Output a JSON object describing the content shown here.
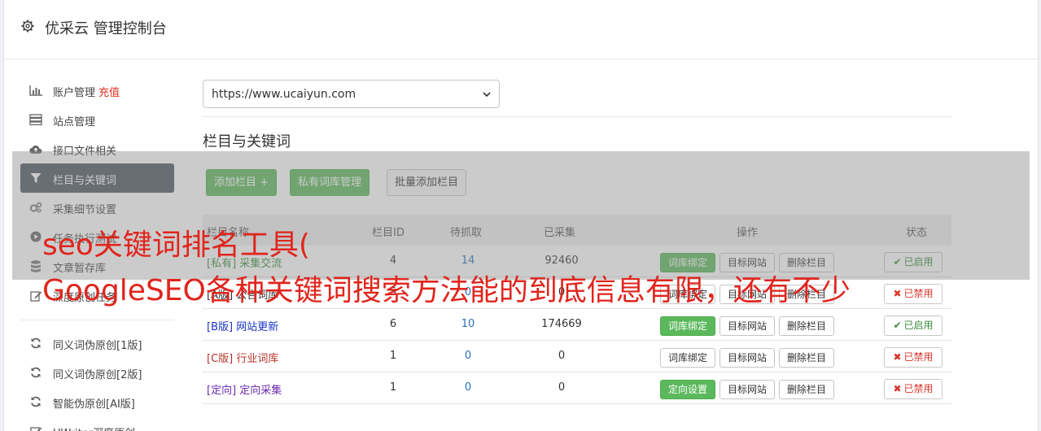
{
  "header": {
    "title": "优采云 管理控制台",
    "icon": "gear-icon"
  },
  "sidebar": {
    "group1": [
      {
        "label": "账户管理",
        "extra": "充值",
        "icon": "bar-chart-icon"
      },
      {
        "label": "站点管理",
        "icon": "server-icon"
      },
      {
        "label": "接口文件相关",
        "icon": "cloud-upload-icon"
      },
      {
        "label": "栏目与关键词",
        "icon": "filter-icon",
        "active": true
      },
      {
        "label": "采集细节设置",
        "icon": "cogs-icon"
      },
      {
        "label": "任务执行测试",
        "icon": "play-circle-icon"
      },
      {
        "label": "文章暂存库",
        "icon": "database-icon"
      },
      {
        "label": "深度原创任务",
        "icon": "edit-icon"
      }
    ],
    "group2": [
      {
        "label": "同义词伪原创[1版]",
        "icon": "refresh-icon"
      },
      {
        "label": "同义词伪原创[2版]",
        "icon": "refresh-icon"
      },
      {
        "label": "智能伪原创[AI版]",
        "icon": "refresh-icon"
      },
      {
        "label": "UWriter深度原创",
        "icon": "edit-icon"
      }
    ]
  },
  "main": {
    "site_select": {
      "value": "https://www.ucaiyun.com"
    },
    "section_title": "栏目与关键词",
    "buttons": {
      "add_column": "添加栏目 +",
      "private_lib": "私有词库管理",
      "batch_add": "批量添加栏目"
    },
    "table": {
      "headers": {
        "name": "栏目名称",
        "id": "栏目ID",
        "pending": "待抓取",
        "collected": "已采集",
        "ops": "操作",
        "status": "状态"
      },
      "rows": [
        {
          "tag": "[私有]",
          "name": "采集交流",
          "id": "4",
          "pending": "14",
          "collected": "92460",
          "op1": "词库绑定",
          "op2": "目标网站",
          "op3": "删除栏目",
          "status": "已启用",
          "enabled": true,
          "tag_color": "#3a8a3a",
          "op1_green": true
        },
        {
          "tag": "[A版]",
          "name": "公告词库",
          "id": "5",
          "pending": "0",
          "collected": "0",
          "op1": "词库绑定",
          "op2": "目标网站",
          "op3": "删除栏目",
          "status": "已禁用",
          "enabled": false,
          "tag_color": "#333333",
          "op1_green": false
        },
        {
          "tag": "[B版]",
          "name": "网站更新",
          "id": "6",
          "pending": "10",
          "collected": "174669",
          "op1": "词库绑定",
          "op2": "目标网站",
          "op3": "删除栏目",
          "status": "已启用",
          "enabled": true,
          "tag_color": "#1a35c9",
          "op1_green": true
        },
        {
          "tag": "[C版]",
          "name": "行业词库",
          "id": "1",
          "pending": "0",
          "collected": "0",
          "op1": "词库绑定",
          "op2": "目标网站",
          "op3": "删除栏目",
          "status": "已禁用",
          "enabled": false,
          "tag_color": "#b8332b",
          "op1_green": false
        },
        {
          "tag": "[定向]",
          "name": "定向采集",
          "id": "1",
          "pending": "0",
          "collected": "0",
          "op1": "定向设置",
          "op2": "目标网站",
          "op3": "删除栏目",
          "status": "已禁用",
          "enabled": false,
          "tag_color": "#6a2cb0",
          "op1_green": true
        }
      ]
    }
  },
  "overlay": {
    "line1": "seo关键词排名工具(",
    "line2": "GoogleSEO各种关键词搜索方法能的到底信息有限，还有不少"
  },
  "colors": {
    "green": "#5cb85c",
    "sidebar_active": "#4d5662",
    "red_text": "#e0251d",
    "link_blue": "#2a6fb5"
  }
}
